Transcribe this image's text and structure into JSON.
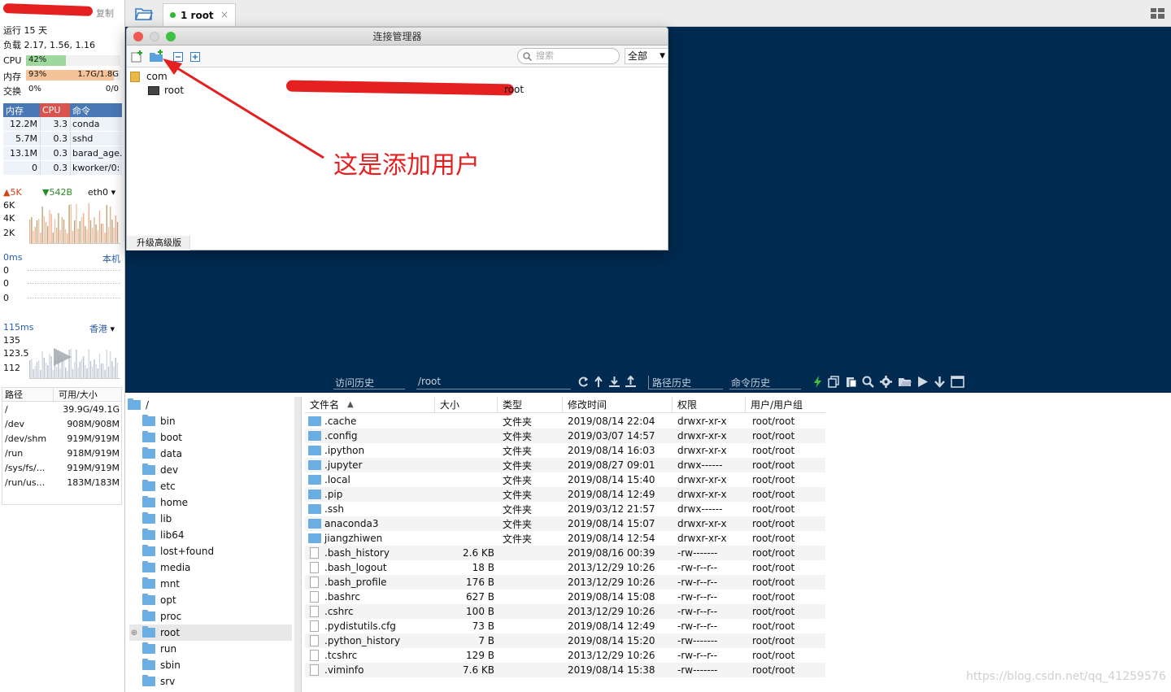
{
  "left": {
    "copy_label": "复制",
    "uptime": "运行 15 天",
    "load": "负载 2.17, 1.56, 1.16",
    "cpu": {
      "label": "CPU",
      "pct": "42%",
      "fill": 0.42
    },
    "mem": {
      "label": "内存",
      "pct": "93%",
      "value": "1.7G/1.8G",
      "fill": 0.93
    },
    "swap": {
      "label": "交换",
      "pct": "0%",
      "value": "0/0",
      "fill": 0.0
    },
    "proc_headers": [
      "内存",
      "CPU",
      "命令"
    ],
    "processes": [
      {
        "mem": "12.2M",
        "cpu": "3.3",
        "cmd": "conda"
      },
      {
        "mem": "5.7M",
        "cpu": "0.3",
        "cmd": "sshd"
      },
      {
        "mem": "13.1M",
        "cpu": "0.3",
        "cmd": "barad_age."
      },
      {
        "mem": "0",
        "cpu": "0.3",
        "cmd": "kworker/0:"
      }
    ],
    "net": {
      "up": "5K",
      "down": "542B",
      "iface": "eth0",
      "ticks": [
        "6K",
        "4K",
        "2K"
      ]
    },
    "ping_local": {
      "label": "0ms",
      "target": "本机",
      "ticks": [
        "0",
        "0",
        "0"
      ]
    },
    "ping_hk": {
      "label": "115ms",
      "target": "香港",
      "ticks": [
        "135",
        "123.5",
        "112"
      ]
    },
    "fs_headers": [
      "路径",
      "可用/大小"
    ],
    "filesystems": [
      {
        "path": "/",
        "size": "39.9G/49.1G"
      },
      {
        "path": "/dev",
        "size": "908M/908M"
      },
      {
        "path": "/dev/shm",
        "size": "919M/919M"
      },
      {
        "path": "/run",
        "size": "918M/919M"
      },
      {
        "path": "/sys/fs/...",
        "size": "919M/919M"
      },
      {
        "path": "/run/us...",
        "size": "183M/183M"
      }
    ]
  },
  "tab": {
    "label": "1 root",
    "close": "×"
  },
  "toolbar": {
    "history": "访问历史",
    "path": "/root",
    "path_history": "路径历史",
    "cmd_history": "命令历史"
  },
  "tree": {
    "root": "/",
    "items": [
      "bin",
      "boot",
      "data",
      "dev",
      "etc",
      "home",
      "lib",
      "lib64",
      "lost+found",
      "media",
      "mnt",
      "opt",
      "proc",
      "root",
      "run",
      "sbin",
      "srv"
    ]
  },
  "files": {
    "headers": {
      "name": "文件名",
      "size": "大小",
      "type": "类型",
      "mtime": "修改时间",
      "perm": "权限",
      "owner": "用户/用户组"
    },
    "rows": [
      {
        "name": ".cache",
        "size": "",
        "type": "文件夹",
        "mtime": "2019/08/14 22:04",
        "perm": "drwxr-xr-x",
        "owner": "root/root",
        "dir": true
      },
      {
        "name": ".config",
        "size": "",
        "type": "文件夹",
        "mtime": "2019/03/07 14:57",
        "perm": "drwxr-xr-x",
        "owner": "root/root",
        "dir": true
      },
      {
        "name": ".ipython",
        "size": "",
        "type": "文件夹",
        "mtime": "2019/08/14 16:03",
        "perm": "drwxr-xr-x",
        "owner": "root/root",
        "dir": true
      },
      {
        "name": ".jupyter",
        "size": "",
        "type": "文件夹",
        "mtime": "2019/08/27 09:01",
        "perm": "drwx------",
        "owner": "root/root",
        "dir": true
      },
      {
        "name": ".local",
        "size": "",
        "type": "文件夹",
        "mtime": "2019/08/14 15:40",
        "perm": "drwxr-xr-x",
        "owner": "root/root",
        "dir": true
      },
      {
        "name": ".pip",
        "size": "",
        "type": "文件夹",
        "mtime": "2019/08/14 12:49",
        "perm": "drwxr-xr-x",
        "owner": "root/root",
        "dir": true
      },
      {
        "name": ".ssh",
        "size": "",
        "type": "文件夹",
        "mtime": "2019/03/12 21:57",
        "perm": "drwx------",
        "owner": "root/root",
        "dir": true
      },
      {
        "name": "anaconda3",
        "size": "",
        "type": "文件夹",
        "mtime": "2019/08/14 15:07",
        "perm": "drwxr-xr-x",
        "owner": "root/root",
        "dir": true
      },
      {
        "name": "jiangzhiwen",
        "size": "",
        "type": "文件夹",
        "mtime": "2019/08/14 12:54",
        "perm": "drwxr-xr-x",
        "owner": "root/root",
        "dir": true
      },
      {
        "name": ".bash_history",
        "size": "2.6 KB",
        "type": "",
        "mtime": "2019/08/16 00:39",
        "perm": "-rw-------",
        "owner": "root/root",
        "dir": false
      },
      {
        "name": ".bash_logout",
        "size": "18 B",
        "type": "",
        "mtime": "2013/12/29 10:26",
        "perm": "-rw-r--r--",
        "owner": "root/root",
        "dir": false
      },
      {
        "name": ".bash_profile",
        "size": "176 B",
        "type": "",
        "mtime": "2013/12/29 10:26",
        "perm": "-rw-r--r--",
        "owner": "root/root",
        "dir": false
      },
      {
        "name": ".bashrc",
        "size": "627 B",
        "type": "",
        "mtime": "2019/08/14 15:08",
        "perm": "-rw-r--r--",
        "owner": "root/root",
        "dir": false
      },
      {
        "name": ".cshrc",
        "size": "100 B",
        "type": "",
        "mtime": "2013/12/29 10:26",
        "perm": "-rw-r--r--",
        "owner": "root/root",
        "dir": false
      },
      {
        "name": ".pydistutils.cfg",
        "size": "73 B",
        "type": "",
        "mtime": "2019/08/14 12:49",
        "perm": "-rw-r--r--",
        "owner": "root/root",
        "dir": false
      },
      {
        "name": ".python_history",
        "size": "7 B",
        "type": "",
        "mtime": "2019/08/14 15:20",
        "perm": "-rw-------",
        "owner": "root/root",
        "dir": false
      },
      {
        "name": ".tcshrc",
        "size": "129 B",
        "type": "",
        "mtime": "2013/12/29 10:26",
        "perm": "-rw-r--r--",
        "owner": "root/root",
        "dir": false
      },
      {
        "name": ".viminfo",
        "size": "7.6 KB",
        "type": "",
        "mtime": "2019/08/14 15:38",
        "perm": "-rw-------",
        "owner": "root/root",
        "dir": false
      }
    ]
  },
  "modal": {
    "title": "连接管理器",
    "search_placeholder": "搜索",
    "filter": "全部",
    "group": "com",
    "session": "root",
    "session_user": "root",
    "upgrade": "升级高级版"
  },
  "annotation": "这是添加用户",
  "watermark": "https://blog.csdn.net/qq_41259576",
  "colors": {
    "terminal_bg": "#002a50",
    "accent_red": "#e52020",
    "cpu_fill": "#9fd89f",
    "mem_fill": "#f5b988",
    "header_blue": "#4a78b5",
    "header_red": "#d9534f"
  }
}
